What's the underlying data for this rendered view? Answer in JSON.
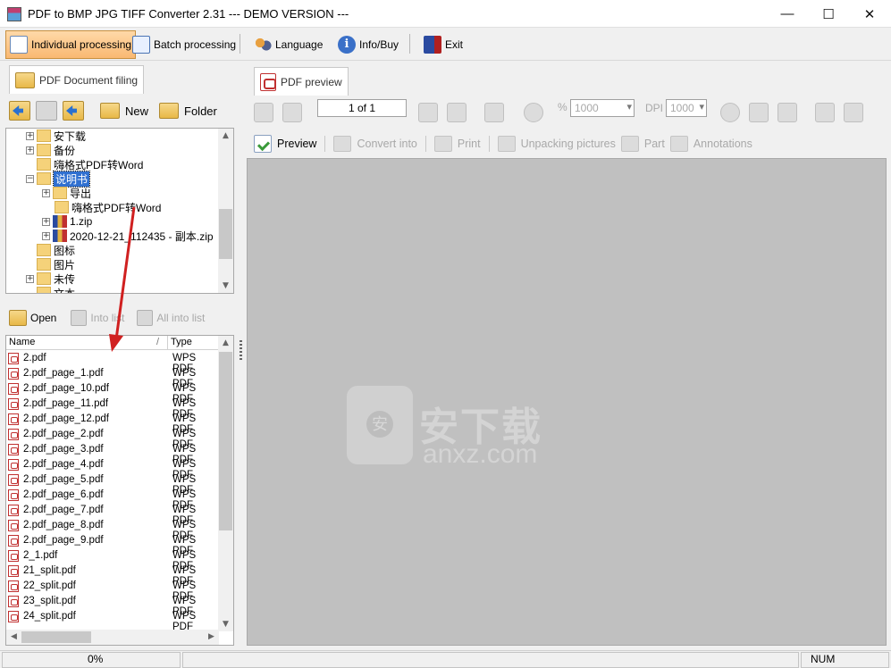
{
  "window": {
    "title": "PDF to BMP JPG TIFF Converter 2.31 --- DEMO VERSION ---",
    "minimize": "—",
    "maximize": "☐",
    "close": "✕"
  },
  "toolbar": {
    "individual": "Individual processing",
    "batch": "Batch processing",
    "language": "Language",
    "info": "Info/Buy",
    "exit": "Exit"
  },
  "left": {
    "tab_label": "PDF Document filing",
    "new_label": "New",
    "folder_label": "Folder",
    "tree": [
      {
        "label": "安下载",
        "expander": "+"
      },
      {
        "label": "备份",
        "expander": "+"
      },
      {
        "label": "嗨格式PDF转Word",
        "expander": ""
      },
      {
        "label": "说明书",
        "expander": "−"
      },
      {
        "label": "导出",
        "expander": "+"
      },
      {
        "label": "嗨格式PDF转Word",
        "expander": ""
      },
      {
        "label": "1.zip",
        "expander": "+"
      },
      {
        "label": "2020-12-21_112435 - 副本.zip",
        "expander": "+"
      },
      {
        "label": "图标",
        "expander": ""
      },
      {
        "label": "图片",
        "expander": ""
      },
      {
        "label": "未传",
        "expander": "+"
      },
      {
        "label": "文本",
        "expander": ""
      }
    ],
    "list_toolbar": {
      "open": "Open",
      "into_list": "Into list",
      "all_into_list": "All into list"
    },
    "columns": {
      "name": "Name",
      "type": "Type",
      "sort": "/"
    },
    "files": [
      {
        "name": "2.pdf",
        "type": "WPS PDF"
      },
      {
        "name": "2.pdf_page_1.pdf",
        "type": "WPS PDF"
      },
      {
        "name": "2.pdf_page_10.pdf",
        "type": "WPS PDF"
      },
      {
        "name": "2.pdf_page_11.pdf",
        "type": "WPS PDF"
      },
      {
        "name": "2.pdf_page_12.pdf",
        "type": "WPS PDF"
      },
      {
        "name": "2.pdf_page_2.pdf",
        "type": "WPS PDF"
      },
      {
        "name": "2.pdf_page_3.pdf",
        "type": "WPS PDF"
      },
      {
        "name": "2.pdf_page_4.pdf",
        "type": "WPS PDF"
      },
      {
        "name": "2.pdf_page_5.pdf",
        "type": "WPS PDF"
      },
      {
        "name": "2.pdf_page_6.pdf",
        "type": "WPS PDF"
      },
      {
        "name": "2.pdf_page_7.pdf",
        "type": "WPS PDF"
      },
      {
        "name": "2.pdf_page_8.pdf",
        "type": "WPS PDF"
      },
      {
        "name": "2.pdf_page_9.pdf",
        "type": "WPS PDF"
      },
      {
        "name": "2_1.pdf",
        "type": "WPS PDF"
      },
      {
        "name": "21_split.pdf",
        "type": "WPS PDF"
      },
      {
        "name": "22_split.pdf",
        "type": "WPS PDF"
      },
      {
        "name": "23_split.pdf",
        "type": "WPS PDF"
      },
      {
        "name": "24_split.pdf",
        "type": "WPS PDF"
      }
    ]
  },
  "right": {
    "tab_label": "PDF preview",
    "page_of": "1 of 1",
    "percent_sign": "%",
    "zoom_value": "1000",
    "dpi_label": "DPI",
    "dpi_value": "1000",
    "preview": "Preview",
    "convert": "Convert into",
    "print": "Print",
    "unpacking": "Unpacking pictures",
    "part": "Part",
    "annotations": "Annotations"
  },
  "watermark": {
    "brand": "安下载",
    "url": "anxz.com"
  },
  "status": {
    "progress": "0%",
    "num": "NUM"
  }
}
